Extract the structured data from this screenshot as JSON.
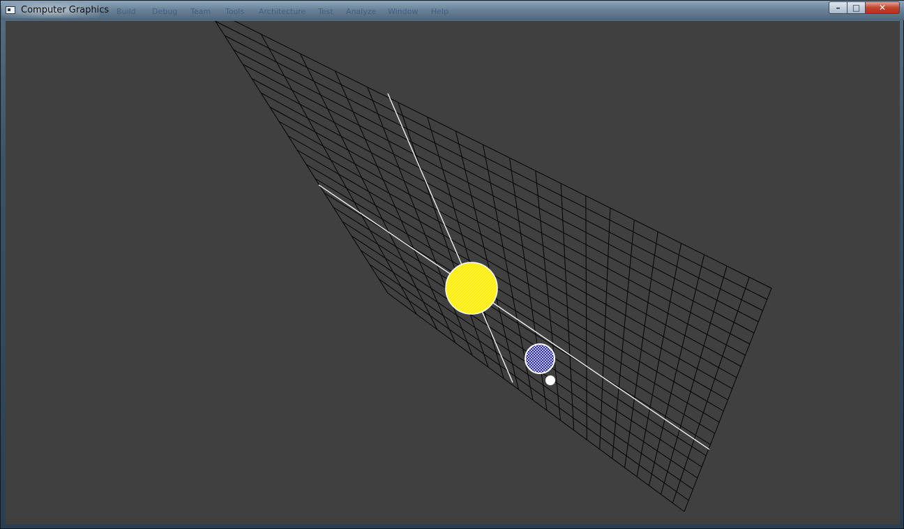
{
  "window": {
    "title": "Computer Graphics",
    "icon": "console-app-icon",
    "ghost_menu": [
      "Build",
      "Debug",
      "Team",
      "Tools",
      "Architecture",
      "Test",
      "Analyze",
      "Window",
      "Help"
    ],
    "controls": {
      "minimize": "–",
      "maximize": "□",
      "close": "✕"
    }
  },
  "scene": {
    "background": "#404040",
    "grid_color": "#000000",
    "axis_color": "#ffffff",
    "grid_divisions": 20,
    "sun": {
      "color": "#ffee00",
      "outline": "#ffffff"
    },
    "planet": {
      "color": "#1a1a9e",
      "outline": "#ffffff"
    },
    "moon": {
      "color": "#ffffff"
    }
  }
}
